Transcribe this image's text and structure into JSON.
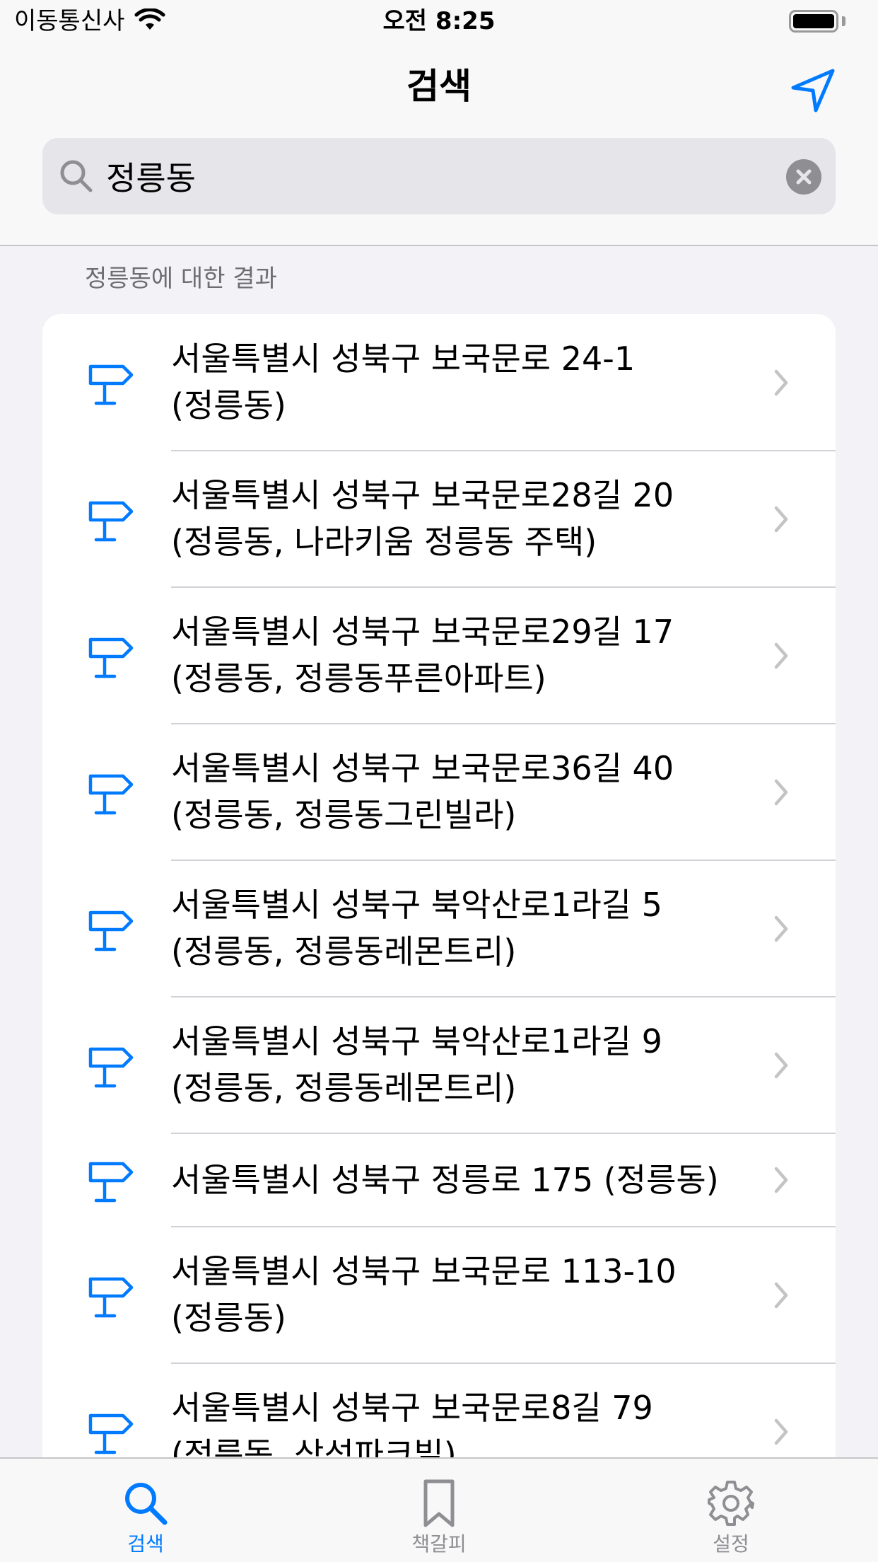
{
  "status_bar": {
    "carrier": "이동통신사",
    "time": "오전 8:25"
  },
  "nav": {
    "title": "검색"
  },
  "search": {
    "value": "정릉동"
  },
  "section_header": "정릉동에 대한 결과",
  "results": [
    {
      "line1": "서울특별시 성북구 보국문로 24-1",
      "line2": "(정릉동)"
    },
    {
      "line1": "서울특별시 성북구 보국문로28길 20",
      "line2": "(정릉동, 나라키움 정릉동 주택)"
    },
    {
      "line1": "서울특별시 성북구 보국문로29길 17",
      "line2": "(정릉동, 정릉동푸른아파트)"
    },
    {
      "line1": "서울특별시 성북구 보국문로36길 40",
      "line2": "(정릉동, 정릉동그린빌라)"
    },
    {
      "line1": "서울특별시 성북구 북악산로1라길 5",
      "line2": "(정릉동, 정릉동레몬트리)"
    },
    {
      "line1": "서울특별시 성북구 북악산로1라길 9",
      "line2": "(정릉동, 정릉동레몬트리)"
    },
    {
      "line1": "서울특별시 성북구 정릉로 175 (정릉동)",
      "line2": ""
    },
    {
      "line1": "서울특별시 성북구 보국문로 113-10",
      "line2": "(정릉동)"
    },
    {
      "line1": "서울특별시 성북구 보국문로8길 79",
      "line2": "(정릉동, 삼성파크빌)"
    }
  ],
  "tabs": [
    {
      "label": "검색",
      "icon": "search-icon",
      "active": true
    },
    {
      "label": "책갈피",
      "icon": "bookmark-icon",
      "active": false
    },
    {
      "label": "설정",
      "icon": "gear-icon",
      "active": false
    }
  ],
  "colors": {
    "accent": "#007aff",
    "inactive": "#8e8e93",
    "background": "#f2f2f7"
  }
}
